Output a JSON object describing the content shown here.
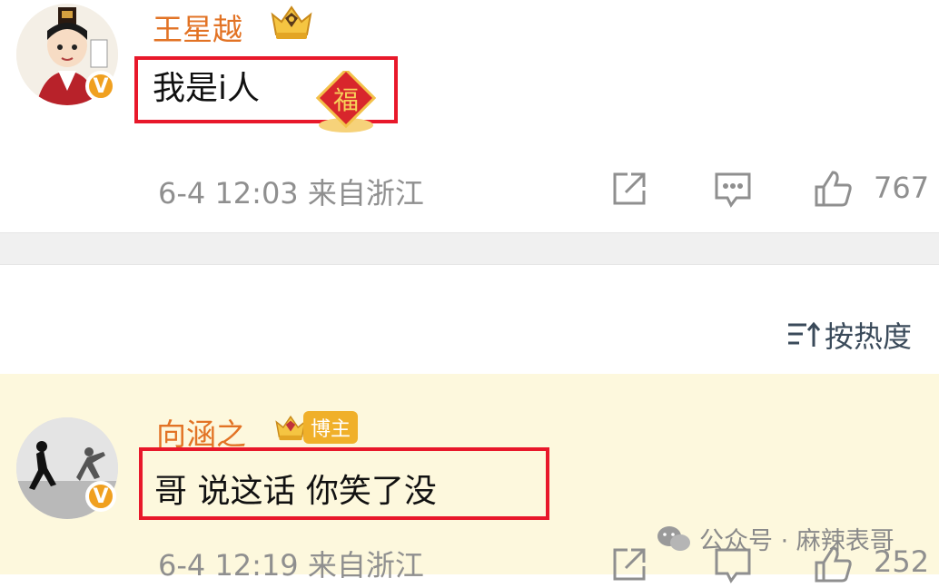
{
  "comments": [
    {
      "username": "王星越",
      "text": "我是i人",
      "meta": "6-4 12:03 来自浙江",
      "like_count": "767",
      "sticker_char": "福"
    },
    {
      "username": "向涵之",
      "badge": "博主",
      "text": "哥 说这话 你笑了没",
      "meta": "6-4 12:19 来自浙江",
      "like_count": "252"
    }
  ],
  "sort": {
    "label": "按热度"
  },
  "watermark": {
    "text": "公众号 · 麻辣表哥"
  },
  "colors": {
    "username": "#e27325",
    "highlight_border": "#e8182a",
    "highlight_bg": "#fdf8dd",
    "meta": "#8f8f8f",
    "vip_badge": "#f0a020"
  }
}
